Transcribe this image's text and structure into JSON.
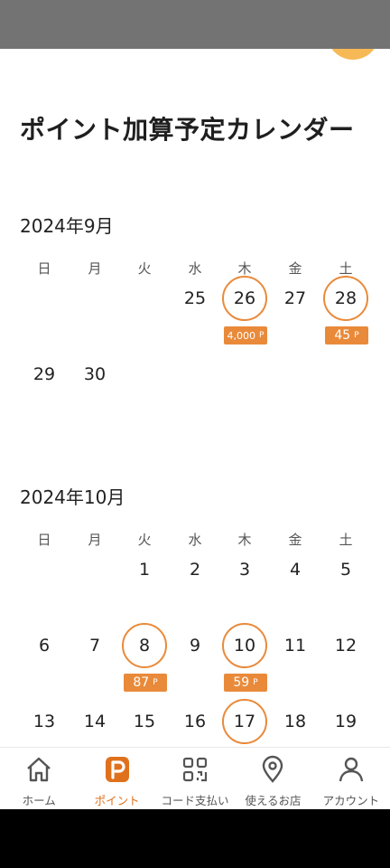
{
  "page_title": "ポイント加算予定カレンダー",
  "weekdays": [
    "日",
    "月",
    "火",
    "水",
    "木",
    "金",
    "土"
  ],
  "months": [
    {
      "title": "2024年9月",
      "days": [
        {
          "d": "25",
          "col": 3,
          "row": 0
        },
        {
          "d": "26",
          "col": 4,
          "row": 0,
          "points": "4,000",
          "unit": "P"
        },
        {
          "d": "27",
          "col": 5,
          "row": 0
        },
        {
          "d": "28",
          "col": 6,
          "row": 0,
          "points": "45",
          "unit": "P"
        },
        {
          "d": "29",
          "col": 0,
          "row": 1
        },
        {
          "d": "30",
          "col": 1,
          "row": 1
        }
      ]
    },
    {
      "title": "2024年10月",
      "days": [
        {
          "d": "1",
          "col": 2,
          "row": 0
        },
        {
          "d": "2",
          "col": 3,
          "row": 0
        },
        {
          "d": "3",
          "col": 4,
          "row": 0
        },
        {
          "d": "4",
          "col": 5,
          "row": 0
        },
        {
          "d": "5",
          "col": 6,
          "row": 0
        },
        {
          "d": "6",
          "col": 0,
          "row": 1
        },
        {
          "d": "7",
          "col": 1,
          "row": 1
        },
        {
          "d": "8",
          "col": 2,
          "row": 1,
          "points": "87",
          "unit": "P"
        },
        {
          "d": "9",
          "col": 3,
          "row": 1
        },
        {
          "d": "10",
          "col": 4,
          "row": 1,
          "points": "59",
          "unit": "P"
        },
        {
          "d": "11",
          "col": 5,
          "row": 1
        },
        {
          "d": "12",
          "col": 6,
          "row": 1
        },
        {
          "d": "13",
          "col": 0,
          "row": 2
        },
        {
          "d": "14",
          "col": 1,
          "row": 2
        },
        {
          "d": "15",
          "col": 2,
          "row": 2
        },
        {
          "d": "16",
          "col": 3,
          "row": 2
        },
        {
          "d": "17",
          "col": 4,
          "row": 2,
          "marked": true
        },
        {
          "d": "18",
          "col": 5,
          "row": 2
        },
        {
          "d": "19",
          "col": 6,
          "row": 2
        }
      ]
    }
  ],
  "nav": [
    {
      "label": "ホーム",
      "icon": "home-icon",
      "active": false
    },
    {
      "label": "ポイント",
      "icon": "points-p-icon",
      "active": true
    },
    {
      "label": "コード支払い",
      "icon": "qr-code-icon",
      "active": false
    },
    {
      "label": "使えるお店",
      "icon": "location-pin-icon",
      "active": false
    },
    {
      "label": "アカウント",
      "icon": "person-icon",
      "active": false
    }
  ],
  "colors": {
    "accent": "#e98a3a",
    "nav_active": "#e0711c",
    "status_bar": "#737373"
  }
}
